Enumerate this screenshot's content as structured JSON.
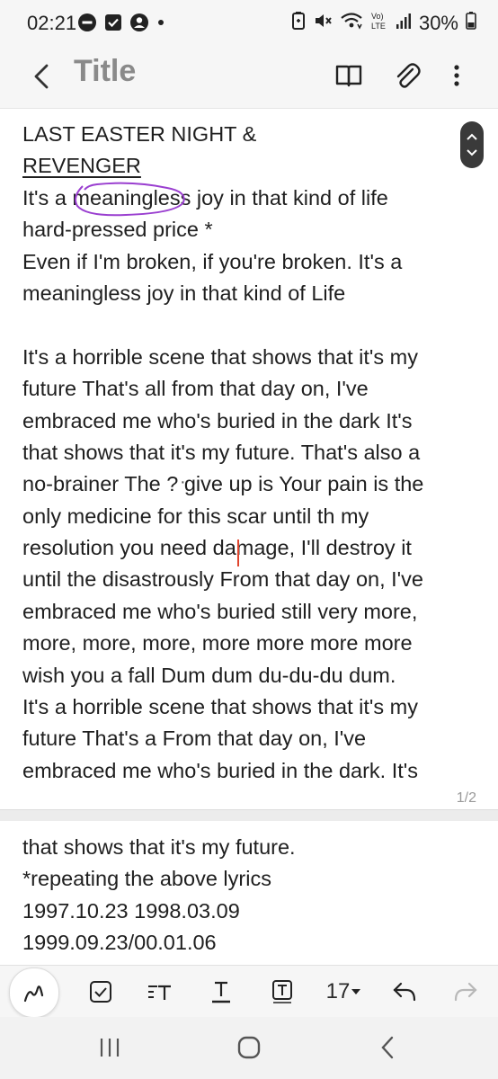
{
  "status_bar": {
    "time": "02:21",
    "battery": "30%",
    "icons": [
      "minus-circle-icon",
      "check-box-icon",
      "account-icon",
      "dot-icon",
      "battery-saver-icon",
      "mute-icon",
      "wifi-icon",
      "volte-icon",
      "signal-icon",
      "battery-icon"
    ]
  },
  "app_bar": {
    "title": "Title",
    "icons": [
      "back-arrow-icon",
      "book-icon",
      "attachment-icon",
      "more-vert-icon"
    ]
  },
  "note": {
    "heading_line1": "LAST EASTER NIGHT &",
    "heading_line2": "REVENGER",
    "page1_lines": [
      "It's a meaningless joy in that kind of life",
      "hard-pressed price *",
      "Even if I'm broken, if you're broken. It's a",
      "meaningless joy in that kind of Life",
      "",
      "It's a horrible scene that shows that it's my",
      "future That's all from that day on, I've",
      "embraced me who's buried in the dark It's",
      "that shows that it's my future. That's also a",
      "no-brainer The ? give up is Your pain is the",
      "only medicine for this scar until th my",
      "resolution you need damage, I'll destroy it",
      "until the disastrously From that day on, I've",
      "embraced me who's buried still very more,",
      "more, more, more, more more more more",
      "wish you a fall Dum dum du-du-du dum.",
      "It's a horrible scene that shows that it's my",
      "future That's a From that day on, I've",
      "embraced me who's buried in the dark. It's"
    ],
    "page_indicator": "1/2",
    "page2_lines": [
      "that shows that it's my future.",
      "*repeating the above lyrics",
      "1997.10.23 1998.03.09",
      "1999.09.23/00.01.06"
    ]
  },
  "toolbar": {
    "font_size": "17",
    "icons": [
      "pen-icon",
      "checkbox-icon",
      "text-style-icon",
      "text-underline-icon",
      "text-box-icon",
      "dropdown-arrow-icon",
      "undo-icon",
      "redo-icon"
    ]
  },
  "nav_bar": {
    "icons": [
      "recents-icon",
      "home-icon",
      "back-icon"
    ]
  }
}
